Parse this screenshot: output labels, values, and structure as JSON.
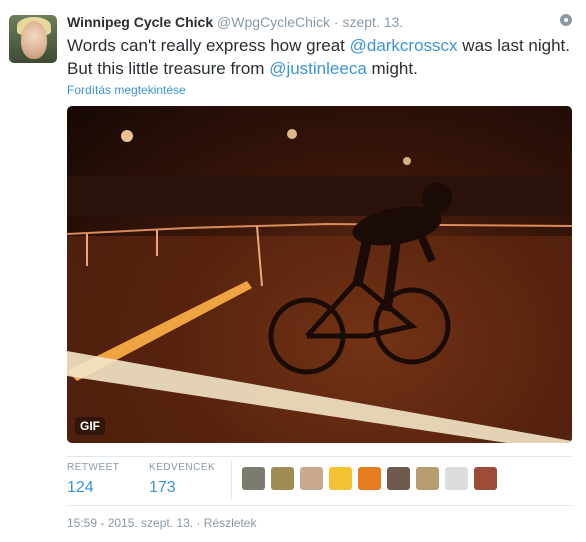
{
  "tweet": {
    "fullname": "Winnipeg Cycle Chick",
    "username": "@WpgCycleChick",
    "separator": "·",
    "time": "szept. 13.",
    "text_part1": "Words can't really express how great ",
    "mention1": "@darkcrosscx",
    "text_part2": " was last night. But this little treasure from ",
    "mention2": "@justinleeca",
    "text_part3": " might.",
    "translate": "Fordítás megtekintése"
  },
  "media": {
    "badge": "GIF",
    "colors": {
      "base": "#3d170a",
      "glow": "#ffb347",
      "tape": "#f4e6c9"
    }
  },
  "stats": {
    "retweet_label": "RETWEET",
    "retweet_count": "124",
    "favorite_label": "KEDVENCEK",
    "favorite_count": "173"
  },
  "favoriters": [
    {
      "color": "#7c7c6e"
    },
    {
      "color": "#a18c56"
    },
    {
      "color": "#c8a98e"
    },
    {
      "color": "#f2c230"
    },
    {
      "color": "#e57c1e"
    },
    {
      "color": "#6e5a4c"
    },
    {
      "color": "#b79c72"
    },
    {
      "color": "#dddddd"
    },
    {
      "color": "#9e4b3a"
    }
  ],
  "footer": {
    "timestamp": "15:59 - 2015. szept. 13.",
    "separator": "·",
    "details": "Részletek"
  },
  "icons": {
    "gear": "gear-icon"
  }
}
